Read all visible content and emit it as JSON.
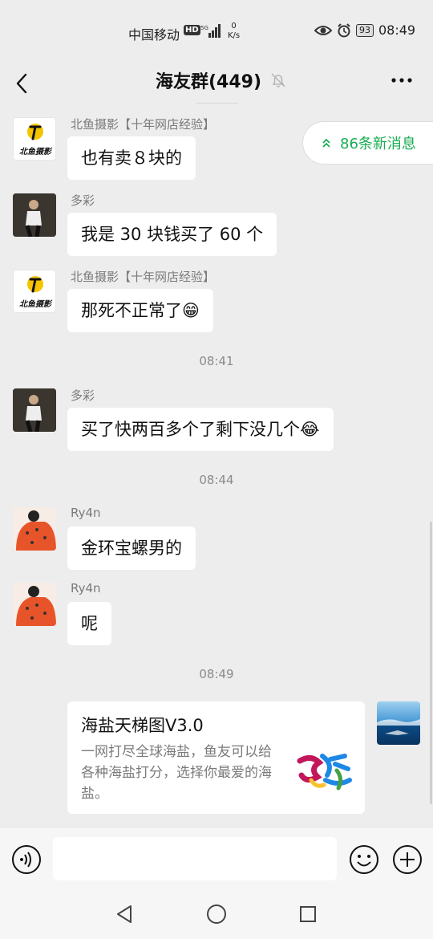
{
  "status_bar": {
    "carrier": "中国移动",
    "hd": "HD",
    "speed_value": "0",
    "speed_unit": "K/s",
    "battery": "93",
    "time": "08:49"
  },
  "header": {
    "title": "海友群(449)",
    "icons": [
      "back-icon",
      "bell-muted-icon",
      "more-icon"
    ]
  },
  "new_messages_banner": "86条新消息",
  "messages": [
    {
      "sender": "北鱼摄影【十年网店经验】",
      "text": "也有卖８块的",
      "avatar": "beiyu"
    },
    {
      "sender": "多彩",
      "text": "我是 30 块钱买了 60 个",
      "avatar": "duocai"
    },
    {
      "sender": "北鱼摄影【十年网店经验】",
      "text": "那死不正常了😁",
      "avatar": "beiyu"
    },
    {
      "sender": "多彩",
      "text": "买了快两百多个了剩下没几个😂",
      "avatar": "duocai"
    },
    {
      "sender": "Ry4n",
      "text": "金环宝螺男的",
      "avatar": "ry4n"
    },
    {
      "sender": "Ry4n",
      "text": "呢",
      "avatar": "ry4n"
    }
  ],
  "timestamps": [
    "08:41",
    "08:44",
    "08:49"
  ],
  "logo_text": "北鱼摄影",
  "shared_card": {
    "title": "海盐天梯图V3.0",
    "description": "一网打尽全球海盐，鱼友可以给各种海盐打分，选择你最爱的海盐。"
  },
  "colors": {
    "accent_green": "#1aad53",
    "background": "#ededed",
    "bubble": "#ffffff"
  }
}
